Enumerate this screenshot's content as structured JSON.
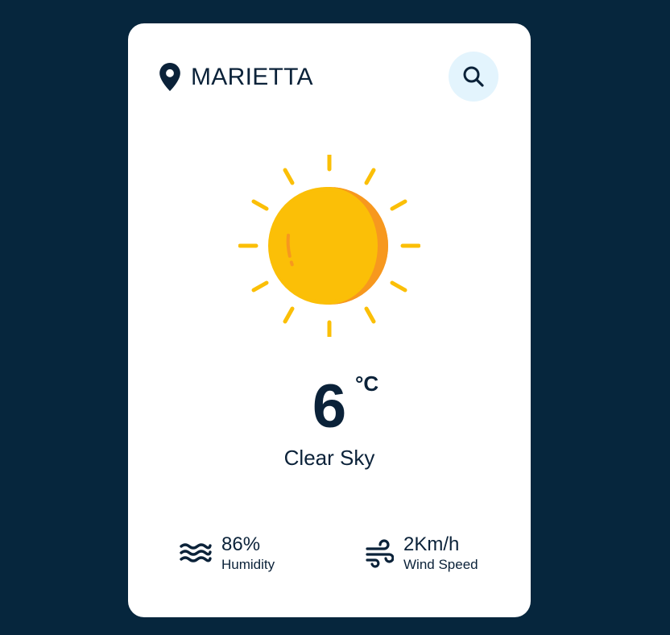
{
  "location": {
    "city": "MARIETTA",
    "icon": "map-pin-icon"
  },
  "search": {
    "icon": "search-icon"
  },
  "weather": {
    "icon": "sun-icon",
    "temperature": "6",
    "unit": "°C",
    "description": "Clear Sky"
  },
  "stats": {
    "humidity": {
      "value": "86%",
      "label": "Humidity",
      "icon": "humidity-waves-icon"
    },
    "wind": {
      "value": "2Km/h",
      "label": "Wind Speed",
      "icon": "wind-icon"
    }
  },
  "colors": {
    "background": "#06263d",
    "card": "#ffffff",
    "text": "#0b2239",
    "search_bg": "#e3f4fd",
    "sun": "#fbbf07",
    "sun_shade": "#f7981e"
  }
}
